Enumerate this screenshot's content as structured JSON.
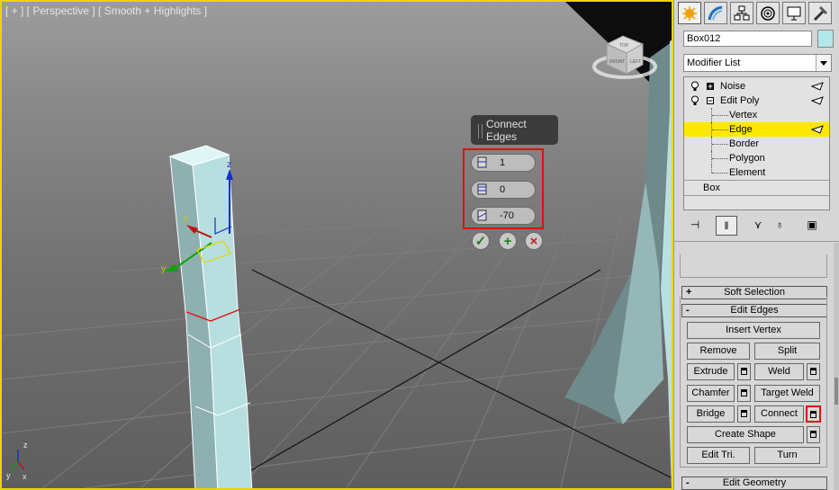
{
  "viewport": {
    "label": "[ + ] [ Perspective ] [ Smooth + Highlights ]",
    "viewcube_faces": [
      "TOP",
      "FRONT",
      "LEFT"
    ],
    "axis_labels": {
      "x": "x",
      "y": "y",
      "z": "z"
    }
  },
  "caddy": {
    "title": "Connect Edges",
    "segments": "1",
    "pinch": "0",
    "slide": "-70",
    "ok_icon": "checkmark-icon",
    "apply_icon": "plus-icon",
    "cancel_icon": "x-icon"
  },
  "panel": {
    "tabs": [
      "create-icon",
      "modify-icon",
      "hierarchy-icon",
      "motion-icon",
      "display-icon",
      "utilities-icon"
    ],
    "object_name": "Box012",
    "object_color": "#b2e8e8",
    "modifier_list": "Modifier List",
    "stack": {
      "noise": "Noise",
      "edit_poly": "Edit Poly",
      "vertex": "Vertex",
      "edge": "Edge",
      "border": "Border",
      "polygon": "Polygon",
      "element": "Element",
      "box": "Box"
    },
    "rollouts": {
      "soft_selection": "Soft Selection",
      "edit_edges": "Edit Edges",
      "edit_geometry": "Edit Geometry"
    },
    "buttons": {
      "insert_vertex": "Insert Vertex",
      "remove": "Remove",
      "split": "Split",
      "extrude": "Extrude",
      "weld": "Weld",
      "chamfer": "Chamfer",
      "target_weld": "Target Weld",
      "bridge": "Bridge",
      "connect": "Connect",
      "create_shape": "Create Shape",
      "edit_tri": "Edit Tri.",
      "turn": "Turn"
    }
  },
  "colors": {
    "selection_yellow": "#ffe800",
    "highlight_red": "#e01010",
    "object_cyan": "#b2e8e8"
  }
}
